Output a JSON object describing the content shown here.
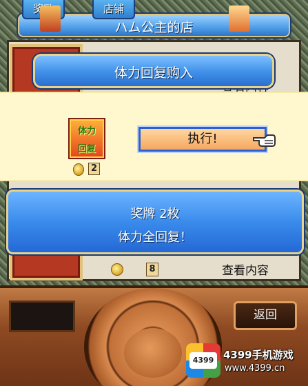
{
  "header": {
    "tab_reward": "奖励",
    "tab_shop": "店铺",
    "title": "ハム公主的店"
  },
  "list": {
    "item1_text": "查看内容",
    "item3_text": "查看内容",
    "item3_cost": "8"
  },
  "dialog": {
    "title": "体力回复购入",
    "item_icon_line1": "体力",
    "item_icon_line2": "回复",
    "cost": "2",
    "execute_label": "执行!",
    "info_line1": "奖牌  2枚",
    "info_line2": "体力全回复！"
  },
  "controls": {
    "back_label": "返回"
  },
  "watermark": {
    "logo_text": "4399",
    "line1": "4399手机游戏",
    "line2": "www.4399.cn"
  }
}
